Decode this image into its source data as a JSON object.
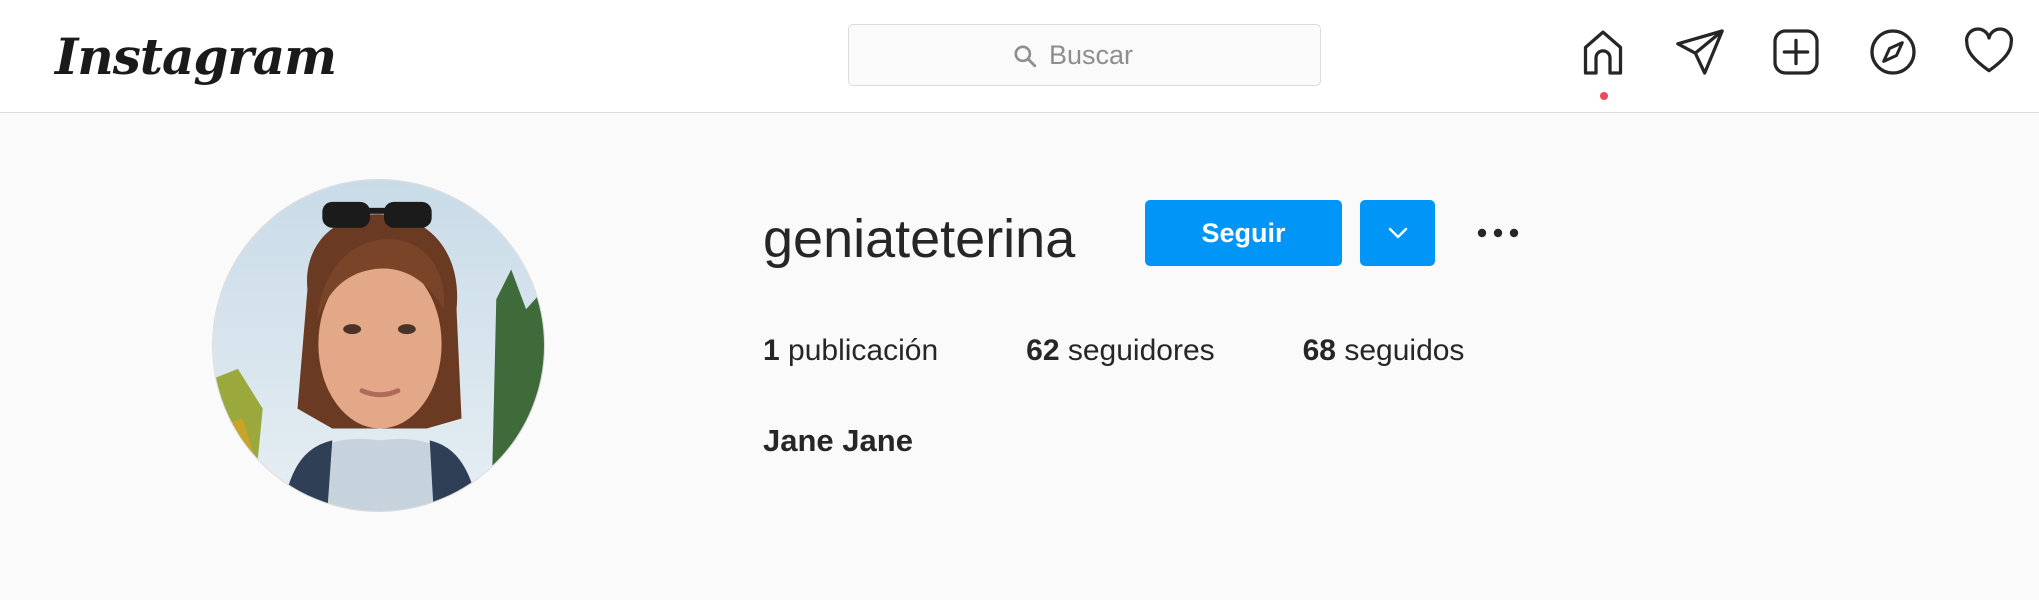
{
  "header": {
    "logo_text": "Instagram",
    "search": {
      "placeholder": "Buscar",
      "value": ""
    },
    "nav_icons": [
      "home-icon",
      "direct-send-icon",
      "new-post-icon",
      "explore-compass-icon",
      "activity-heart-icon"
    ],
    "notification_dot_color": "#ed4956"
  },
  "profile": {
    "username": "geniateterina",
    "follow_label": "Seguir",
    "stats": [
      {
        "count": "1",
        "label": "publicación"
      },
      {
        "count": "62",
        "label": "seguidores"
      },
      {
        "count": "68",
        "label": "seguidos"
      }
    ],
    "full_name": "Jane Jane"
  },
  "colors": {
    "accent_blue": "#0095f6",
    "border": "#dbdbdb",
    "background": "#fafafa",
    "text": "#262626"
  }
}
